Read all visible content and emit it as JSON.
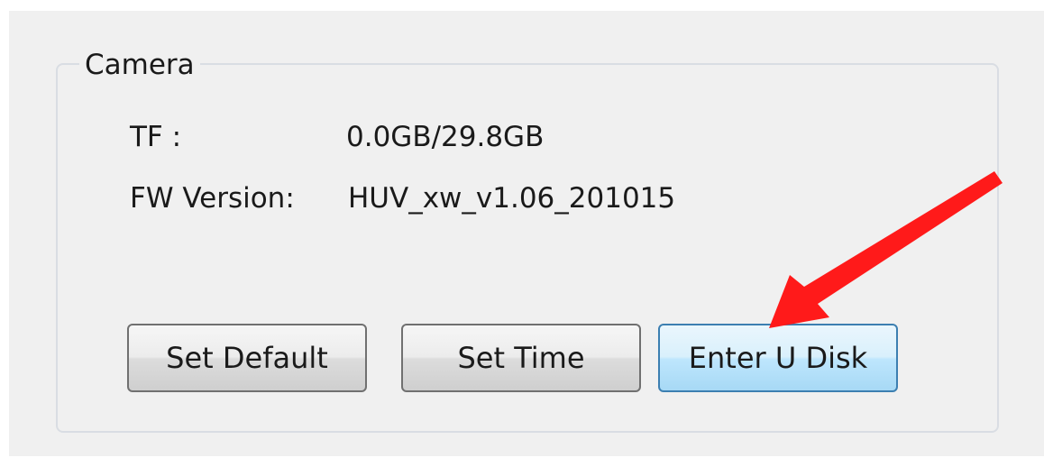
{
  "camera": {
    "group_title": "Camera",
    "tf_label": "TF :",
    "tf_value": "0.0GB/29.8GB",
    "fw_label": "FW Version:",
    "fw_value": "HUV_xw_v1.06_201015"
  },
  "buttons": {
    "set_default": "Set Default",
    "set_time": "Set Time",
    "enter_u_disk": "Enter U Disk"
  },
  "colors": {
    "dialog_bg": "#f0f0f0",
    "hot_button": "#bee6fd",
    "annotation_arrow": "#ff1a1a"
  }
}
